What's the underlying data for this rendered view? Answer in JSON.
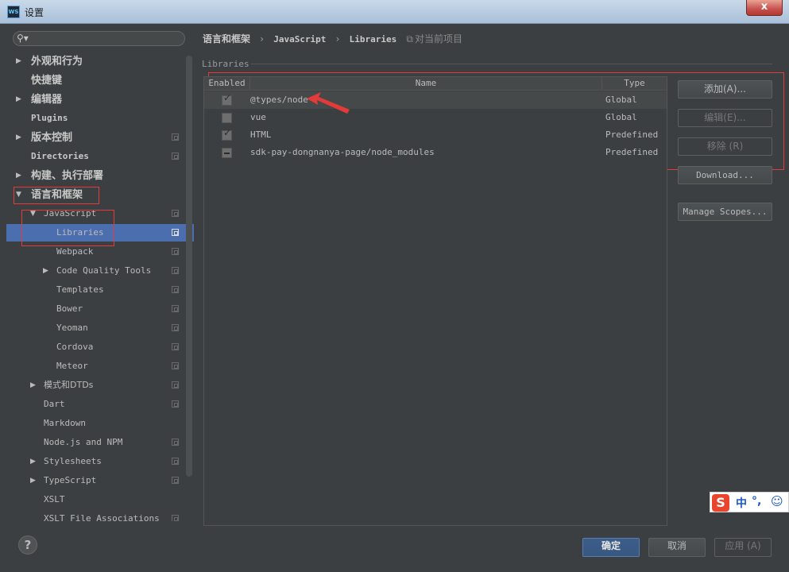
{
  "window": {
    "title": "设置",
    "app_icon": "WS",
    "close_label": "x"
  },
  "search": {
    "placeholder": "",
    "icon": "search-icon"
  },
  "tree": [
    {
      "label": "外观和行为",
      "indent": 0,
      "arrow": "▶",
      "style": "cn",
      "copy": false
    },
    {
      "label": "快捷键",
      "indent": 0,
      "arrow": "",
      "style": "cn",
      "copy": false
    },
    {
      "label": "编辑器",
      "indent": 0,
      "arrow": "▶",
      "style": "cn",
      "copy": false
    },
    {
      "label": "Plugins",
      "indent": 0,
      "arrow": "",
      "style": "bold",
      "copy": false
    },
    {
      "label": "版本控制",
      "indent": 0,
      "arrow": "▶",
      "style": "cn",
      "copy": true
    },
    {
      "label": "Directories",
      "indent": 0,
      "arrow": "",
      "style": "bold",
      "copy": true
    },
    {
      "label": "构建、执行部署",
      "indent": 0,
      "arrow": "▶",
      "style": "cn",
      "copy": false
    },
    {
      "label": "语言和框架",
      "indent": 0,
      "arrow": "▼",
      "style": "cn",
      "copy": false
    },
    {
      "label": "JavaScript",
      "indent": 1,
      "arrow": "▼",
      "style": "",
      "copy": true
    },
    {
      "label": "Libraries",
      "indent": 2,
      "arrow": "",
      "style": "",
      "copy": true,
      "selected": true
    },
    {
      "label": "Webpack",
      "indent": 2,
      "arrow": "",
      "style": "",
      "copy": true
    },
    {
      "label": "Code Quality Tools",
      "indent": 2,
      "arrow": "▶",
      "style": "",
      "copy": true
    },
    {
      "label": "Templates",
      "indent": 2,
      "arrow": "",
      "style": "",
      "copy": true
    },
    {
      "label": "Bower",
      "indent": 2,
      "arrow": "",
      "style": "",
      "copy": true
    },
    {
      "label": "Yeoman",
      "indent": 2,
      "arrow": "",
      "style": "",
      "copy": true
    },
    {
      "label": "Cordova",
      "indent": 2,
      "arrow": "",
      "style": "",
      "copy": true
    },
    {
      "label": "Meteor",
      "indent": 2,
      "arrow": "",
      "style": "",
      "copy": true
    },
    {
      "label": "模式和DTDs",
      "indent": 1,
      "arrow": "▶",
      "style": "cn-light",
      "copy": true
    },
    {
      "label": "Dart",
      "indent": 1,
      "arrow": "",
      "style": "",
      "copy": true
    },
    {
      "label": "Markdown",
      "indent": 1,
      "arrow": "",
      "style": "",
      "copy": false
    },
    {
      "label": "Node.js and NPM",
      "indent": 1,
      "arrow": "",
      "style": "",
      "copy": true
    },
    {
      "label": "Stylesheets",
      "indent": 1,
      "arrow": "▶",
      "style": "",
      "copy": true
    },
    {
      "label": "TypeScript",
      "indent": 1,
      "arrow": "▶",
      "style": "",
      "copy": true
    },
    {
      "label": "XSLT",
      "indent": 1,
      "arrow": "",
      "style": "",
      "copy": false
    },
    {
      "label": "XSLT File Associations",
      "indent": 1,
      "arrow": "",
      "style": "",
      "copy": true
    }
  ],
  "breadcrumb": {
    "parts": [
      "语言和框架",
      "JavaScript",
      "Libraries"
    ],
    "separator": "›",
    "scope": "对当前项目"
  },
  "libraries": {
    "section_label": "Libraries",
    "columns": [
      "Enabled",
      "Name",
      "Type"
    ],
    "rows": [
      {
        "state": "checked",
        "name": "@types/node",
        "type": "Global"
      },
      {
        "state": "unchecked",
        "name": "vue",
        "type": "Global"
      },
      {
        "state": "checked",
        "name": "HTML",
        "type": "Predefined"
      },
      {
        "state": "mixed",
        "name": "sdk-pay-dongnanya-page/node_modules",
        "type": "Predefined"
      }
    ]
  },
  "side_buttons": {
    "add": "添加(A)...",
    "edit": "编辑(E)...",
    "remove": "移除 (R)",
    "download": "Download...",
    "manage_scopes": "Manage Scopes..."
  },
  "footer": {
    "help": "?",
    "ok": "确定",
    "cancel": "取消",
    "apply": "应用 (A)"
  },
  "ime": {
    "logo": "S",
    "mode": "中",
    "punct": "°,",
    "emoji": "☺"
  },
  "colors": {
    "background": "#3c3f41",
    "selection": "#4b6eaf",
    "annotation_red": "#e33a3a"
  }
}
